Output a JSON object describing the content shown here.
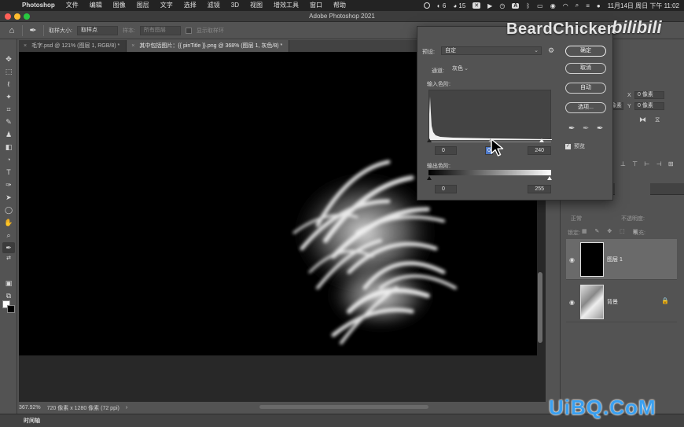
{
  "menubar": {
    "app": "Photoshop",
    "items": [
      "文件",
      "编辑",
      "图像",
      "图层",
      "文字",
      "选择",
      "滤镜",
      "3D",
      "视图",
      "增效工具",
      "窗口",
      "帮助"
    ],
    "status_badge_1": "6",
    "status_badge_2": "15",
    "datetime": "11月14日 周日 下午 11:02"
  },
  "window": {
    "title": "Adobe Photoshop 2021",
    "traffic_colors": [
      "#fe5f57",
      "#febc2e",
      "#28c840"
    ]
  },
  "options_bar": {
    "sample_size_label": "取样大小:",
    "sample_size_value": "取样点",
    "sample_label": "样本:",
    "sample_value": "所有图层",
    "show_ring_label": "显示取样环"
  },
  "tabs": [
    {
      "label": "毛字.psd @ 121% (图层 1, RGB/8) *",
      "active": false
    },
    {
      "label": "其中包括图片：{{ pinTitle }}.png @ 368% (图层 1, 灰色/8) *",
      "active": true
    }
  ],
  "status": {
    "zoom": "367.92%",
    "doc_info": "720 像素 x 1280 像素 (72 ppi)"
  },
  "timeline": {
    "label": "时间轴"
  },
  "properties": {
    "x_value": "0 像素",
    "y_value": "0 像素",
    "w_value": "0 像素",
    "h_value": "0 像素",
    "x_label": "X",
    "y_label": "Y"
  },
  "layers": {
    "blend_mode": "正常",
    "opacity_label": "不透明度:",
    "lock_label": "锁定:",
    "fill_label": "填充:",
    "items": [
      {
        "name": "图层 1",
        "active": true
      },
      {
        "name": "背景",
        "active": false
      }
    ]
  },
  "levels_dialog": {
    "preset_label": "预设:",
    "preset_value": "自定",
    "channel_label": "通道:",
    "channel_value": "灰色",
    "input_label": "输入色阶:",
    "input_black": "0",
    "input_mid": "0.",
    "input_white": "240",
    "output_label": "输出色阶:",
    "output_black": "0",
    "output_white": "255",
    "buttons": {
      "ok": "确定",
      "cancel": "取消",
      "auto": "自动",
      "options": "选项..."
    },
    "preview_label": "预览"
  },
  "watermarks": {
    "channel_name": "BeardChicken",
    "platform": "bilibili",
    "site": "UiBQ.CoM"
  }
}
